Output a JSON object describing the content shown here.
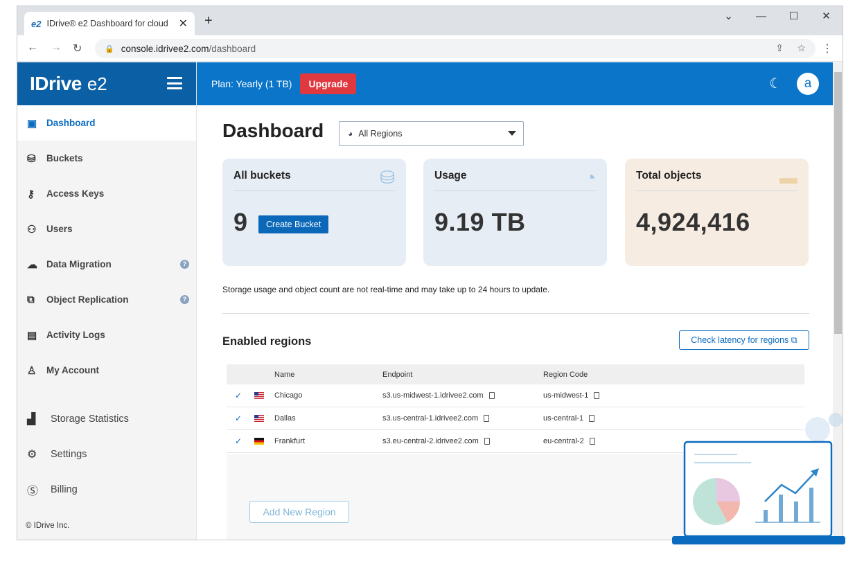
{
  "browser": {
    "tab_title": "IDrive® e2 Dashboard for cloud",
    "tab_favicon": "e2",
    "url_host": "console.idrivee2.com",
    "url_path": "/dashboard"
  },
  "sidebar": {
    "brand": "IDrive",
    "brand_suffix": "e2",
    "items": [
      {
        "label": "Dashboard",
        "icon": "dashboard-icon"
      },
      {
        "label": "Buckets",
        "icon": "bucket-icon"
      },
      {
        "label": "Access Keys",
        "icon": "key-icon"
      },
      {
        "label": "Users",
        "icon": "users-icon"
      },
      {
        "label": "Data Migration",
        "icon": "cloud-migration-icon"
      },
      {
        "label": "Object Replication",
        "icon": "replication-icon"
      },
      {
        "label": "Activity Logs",
        "icon": "document-icon"
      },
      {
        "label": "My Account",
        "icon": "user-icon"
      }
    ],
    "items2": [
      {
        "label": "Storage Statistics",
        "icon": "bar-chart-icon"
      },
      {
        "label": "Settings",
        "icon": "gear-icon"
      },
      {
        "label": "Billing",
        "icon": "dollar-icon"
      }
    ],
    "copyright": "© IDrive Inc."
  },
  "topbar": {
    "plan": "Plan: Yearly (1 TB)",
    "upgrade_label": "Upgrade",
    "avatar_letter": "a"
  },
  "main": {
    "title": "Dashboard",
    "region_select": "All Regions",
    "cards": [
      {
        "title": "All buckets",
        "value": "9",
        "button": "Create Bucket"
      },
      {
        "title": "Usage",
        "value": "9.19 TB"
      },
      {
        "title": "Total objects",
        "value": "4,924,416"
      }
    ],
    "note": "Storage usage and object count are not real-time and may take up to 24 hours to update.",
    "enabled_regions_title": "Enabled regions",
    "latency_button": "Check latency for regions",
    "table": {
      "headers": [
        "Name",
        "Endpoint",
        "Region Code"
      ],
      "rows": [
        {
          "name": "Chicago",
          "flag": "us",
          "endpoint": "s3.us-midwest-1.idrivee2.com",
          "code": "us-midwest-1"
        },
        {
          "name": "Dallas",
          "flag": "us",
          "endpoint": "s3.us-central-1.idrivee2.com",
          "code": "us-central-1"
        },
        {
          "name": "Frankfurt",
          "flag": "de",
          "endpoint": "s3.eu-central-2.idrivee2.com",
          "code": "eu-central-2"
        }
      ]
    },
    "add_region_label": "Add New Region"
  },
  "colors": {
    "brand_dark": "#0b5fa5",
    "topbar": "#0b75c9",
    "upgrade": "#e0383f",
    "card_blue": "#e6edf5",
    "card_beige": "#f6ece1"
  }
}
